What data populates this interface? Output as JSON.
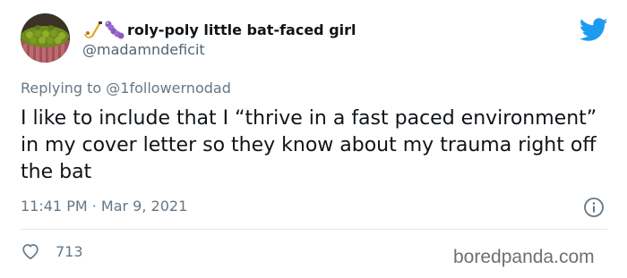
{
  "tweet": {
    "display_name": "roly-poly little bat-faced girl",
    "handle": "@madamndeficit",
    "replying_to": "Replying to @1followernodad",
    "text": "I like to include that I “thrive in a fast paced environment” in my cover letter so they know about my trauma right off the bat",
    "timestamp": "11:41 PM · Mar 9, 2021",
    "like_count": "713",
    "emojis": [
      "saxophone-emoji",
      "caterpillar-emoji"
    ]
  },
  "watermark": "boredpanda.com",
  "colors": {
    "twitter_blue": "#1d9bf0",
    "secondary_text": "#657786",
    "divider": "#e1e8ed",
    "primary_text": "#0f1419"
  },
  "icons": {
    "platform": "twitter-bird-icon",
    "info": "info-icon",
    "like": "heart-icon"
  }
}
